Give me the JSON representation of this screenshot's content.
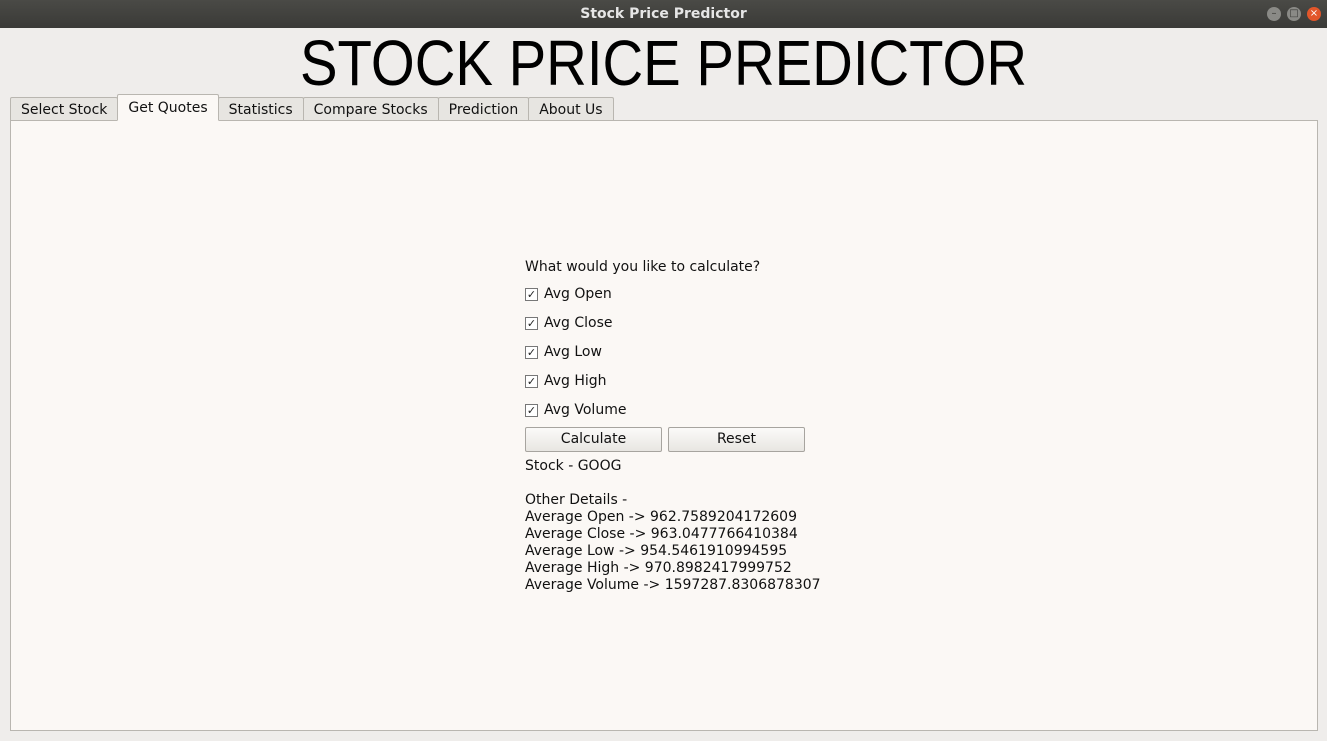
{
  "window": {
    "title": "Stock Price Predictor",
    "controls": {
      "minimize": "–",
      "maximize": "□",
      "close": "×"
    }
  },
  "banner": "STOCK PRICE PREDICTOR",
  "tabs": [
    "Select Stock",
    "Get Quotes",
    "Statistics",
    "Compare Stocks",
    "Prediction",
    "About Us"
  ],
  "active_tab": "Get Quotes",
  "form": {
    "question": "What would you like to calculate?",
    "options": [
      {
        "label": "Avg Open",
        "checked": true
      },
      {
        "label": "Avg Close",
        "checked": true
      },
      {
        "label": "Avg Low",
        "checked": true
      },
      {
        "label": "Avg High",
        "checked": true
      },
      {
        "label": "Avg Volume",
        "checked": true
      }
    ],
    "check_mark": "✓",
    "calculate_label": "Calculate",
    "reset_label": "Reset"
  },
  "results": {
    "stock_line": "Stock - GOOG",
    "details_heading": "Other Details -",
    "lines": [
      "Average Open -> 962.7589204172609",
      "Average Close -> 963.0477766410384",
      "Average Low -> 954.5461910994595",
      "Average High -> 970.8982417999752",
      "Average Volume -> 1597287.8306878307"
    ]
  },
  "colors": {
    "titlebar": "#3f3f3c",
    "close_button": "#e2562a",
    "panel_bg": "#fbf8f5",
    "window_bg": "#efedeb"
  }
}
